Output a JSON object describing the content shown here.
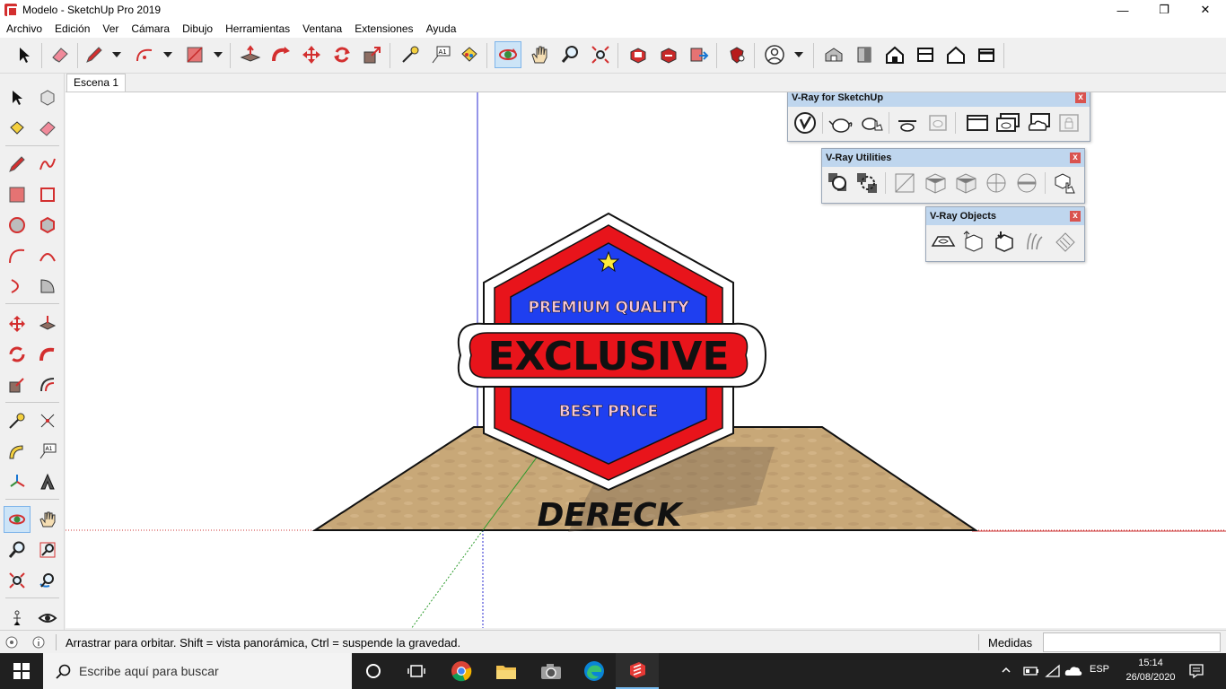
{
  "window": {
    "title": "Modelo - SketchUp Pro 2019",
    "minimize": "—",
    "restore": "❐",
    "close": "✕"
  },
  "menu": [
    "Archivo",
    "Edición",
    "Ver",
    "Cámara",
    "Dibujo",
    "Herramientas",
    "Ventana",
    "Extensiones",
    "Ayuda"
  ],
  "scene_tab": "Escena 1",
  "vray": {
    "main_title": "V-Ray for SketchUp",
    "utilities_title": "V-Ray Utilities",
    "objects_title": "V-Ray Objects",
    "close_glyph": "x"
  },
  "model": {
    "badge_top_text": "PREMIUM QUALITY",
    "badge_main_text": "EXCLUSIVE",
    "badge_bottom_text": "BEST PRICE",
    "base_text": "DERECK"
  },
  "status": {
    "hint": "Arrastrar para orbitar. Shift = vista panorámica, Ctrl = suspende la gravedad.",
    "measure_label": "Medidas",
    "measure_value": ""
  },
  "taskbar": {
    "search_placeholder": "Escribe aquí para buscar",
    "language": "ESP",
    "time": "15:14",
    "date": "26/08/2020"
  },
  "colors": {
    "accent_red": "#e8141b",
    "badge_blue": "#1f3ff0",
    "wood": "#c8a878",
    "selection": "#cce4f7"
  }
}
